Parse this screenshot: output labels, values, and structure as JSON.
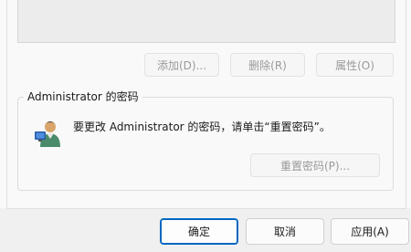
{
  "users_section": {
    "add_button": "添加(D)...",
    "remove_button": "删除(R)",
    "properties_button": "属性(O)"
  },
  "password_group": {
    "title": "Administrator 的密码",
    "instruction": "要更改 Administrator 的密码，请单击“重置密码”。",
    "reset_button": "重置密码(P)...",
    "icon": "user-key-icon"
  },
  "dialog_buttons": {
    "ok": "确定",
    "cancel": "取消",
    "apply": "应用(A)"
  },
  "colors": {
    "accent": "#0067c0",
    "disabled_text": "#9a9a9a"
  }
}
